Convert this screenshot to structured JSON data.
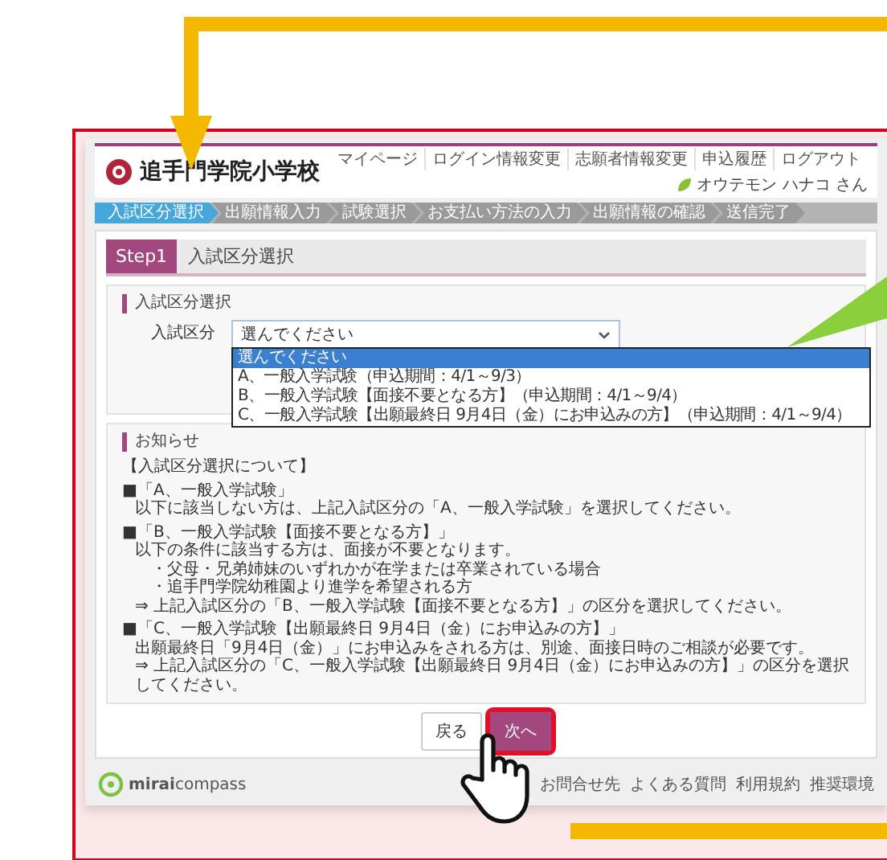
{
  "header": {
    "school_name": "追手門学院小学校",
    "nav": [
      "マイページ",
      "ログイン情報変更",
      "志願者情報変更",
      "申込履歴",
      "ログアウト"
    ],
    "user": "オウテモン ハナコ さん"
  },
  "steps": [
    {
      "label": "入試区分選択",
      "selected": true
    },
    {
      "label": "出願情報入力",
      "selected": false
    },
    {
      "label": "試験選択",
      "selected": false
    },
    {
      "label": "お支払い方法の入力",
      "selected": false
    },
    {
      "label": "出願情報の確認",
      "selected": false
    },
    {
      "label": "送信完了",
      "selected": false
    }
  ],
  "step_title": {
    "badge": "Step1",
    "title": "入試区分選択"
  },
  "selection": {
    "heading": "入試区分選択",
    "label": "入試区分",
    "value": "選んでください",
    "options": [
      {
        "label": "選んでください",
        "selected": true
      },
      {
        "label": "A、一般入学試験（申込期間：4/1～9/3）",
        "selected": false
      },
      {
        "label": "B、一般入学試験【面接不要となる方】（申込期間：4/1～9/4）",
        "selected": false
      },
      {
        "label": "C、一般入学試験【出願最終日 9月4日（金）にお申込みの方】（申込期間：4/1～9/4）",
        "selected": false
      }
    ]
  },
  "notice": {
    "heading": "お知らせ",
    "lines": [
      {
        "kind": "title",
        "text": "【入試区分選択について】"
      },
      {
        "kind": "head",
        "text": "■「A、一般入学試験」"
      },
      {
        "kind": "text",
        "text": "以下に該当しない方は、上記入試区分の「A、一般入学試験」を選択してください。"
      },
      {
        "kind": "head",
        "text": "■「B、一般入学試験【面接不要となる方】」"
      },
      {
        "kind": "text",
        "text": "以下の条件に該当する方は、面接が不要となります。"
      },
      {
        "kind": "sub",
        "text": "・父母・兄弟姉妹のいずれかが在学または卒業されている場合"
      },
      {
        "kind": "sub",
        "text": "・追手門学院幼稚園より進学を希望される方"
      },
      {
        "kind": "text",
        "text": "⇒ 上記入試区分の「B、一般入学試験【面接不要となる方】」の区分を選択してください。"
      },
      {
        "kind": "head",
        "text": "■「C、一般入学試験【出願最終日 9月4日（金）にお申込みの方】」"
      },
      {
        "kind": "text",
        "text": "出願最終日「9月4日（金）」にお申込みをされる方は、別途、面接日時のご相談が必要です。"
      },
      {
        "kind": "text",
        "text": "⇒ 上記入試区分の「C、一般入学試験【出願最終日 9月4日（金）にお申込みの方】」の区分を選択してください。"
      }
    ]
  },
  "buttons": [
    {
      "label": "戻る",
      "kind": "secondary",
      "highlighted": false
    },
    {
      "label": "次へ",
      "kind": "primary",
      "highlighted": true
    }
  ],
  "footer": {
    "brand": "**mirai**compass",
    "links": [
      "お問合せ先",
      "よくある質問",
      "利用規約",
      "推奨環境"
    ]
  }
}
